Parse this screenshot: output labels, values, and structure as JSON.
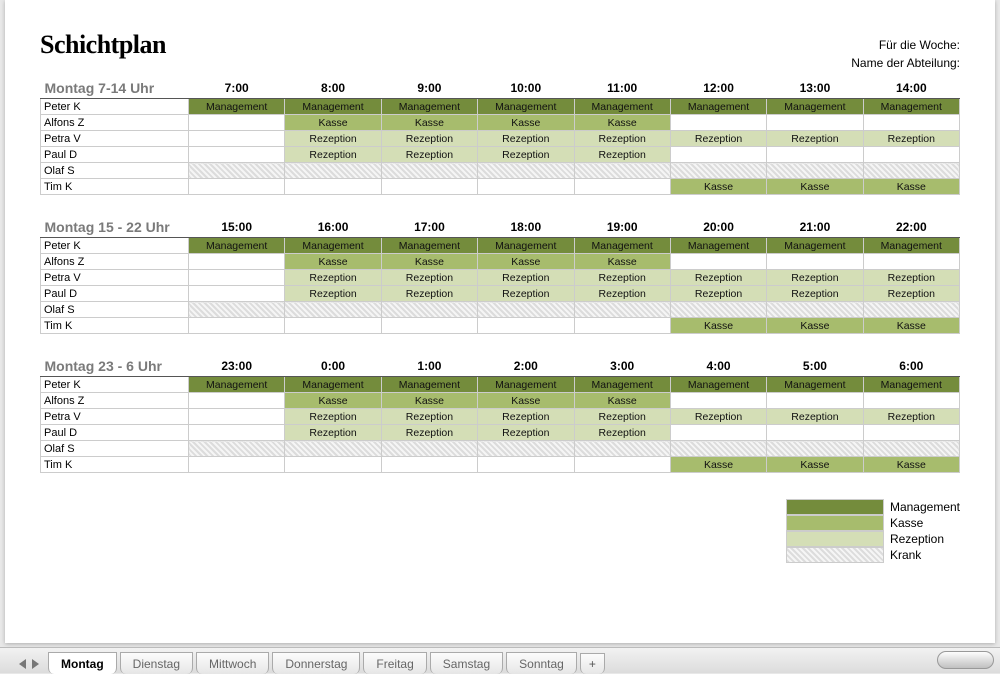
{
  "title": "Schichtplan",
  "meta": {
    "week_label": "Für die Woche:",
    "dept_label": "Name der Abteilung:"
  },
  "blocks": [
    {
      "title": "Montag 7-14 Uhr",
      "hours": [
        "7:00",
        "8:00",
        "9:00",
        "10:00",
        "11:00",
        "12:00",
        "13:00",
        "14:00"
      ],
      "rows": [
        {
          "name": "Peter K",
          "cells": [
            "Management",
            "Management",
            "Management",
            "Management",
            "Management",
            "Management",
            "Management",
            "Management"
          ]
        },
        {
          "name": "Alfons Z",
          "cells": [
            "",
            "Kasse",
            "Kasse",
            "Kasse",
            "Kasse",
            "",
            "",
            ""
          ]
        },
        {
          "name": "Petra V",
          "cells": [
            "",
            "Rezeption",
            "Rezeption",
            "Rezeption",
            "Rezeption",
            "Rezeption",
            "Rezeption",
            "Rezeption"
          ]
        },
        {
          "name": "Paul D",
          "cells": [
            "",
            "Rezeption",
            "Rezeption",
            "Rezeption",
            "Rezeption",
            "",
            "",
            ""
          ]
        },
        {
          "name": "Olaf S",
          "cells": [
            "Krank",
            "Krank",
            "Krank",
            "Krank",
            "Krank",
            "Krank",
            "Krank",
            "Krank"
          ]
        },
        {
          "name": "Tim K",
          "cells": [
            "",
            "",
            "",
            "",
            "",
            "Kasse",
            "Kasse",
            "Kasse"
          ]
        }
      ]
    },
    {
      "title": "Montag 15 - 22 Uhr",
      "hours": [
        "15:00",
        "16:00",
        "17:00",
        "18:00",
        "19:00",
        "20:00",
        "21:00",
        "22:00"
      ],
      "rows": [
        {
          "name": "Peter K",
          "cells": [
            "Management",
            "Management",
            "Management",
            "Management",
            "Management",
            "Management",
            "Management",
            "Management"
          ]
        },
        {
          "name": "Alfons Z",
          "cells": [
            "",
            "Kasse",
            "Kasse",
            "Kasse",
            "Kasse",
            "",
            "",
            ""
          ]
        },
        {
          "name": "Petra V",
          "cells": [
            "",
            "Rezeption",
            "Rezeption",
            "Rezeption",
            "Rezeption",
            "Rezeption",
            "Rezeption",
            "Rezeption"
          ]
        },
        {
          "name": "Paul D",
          "cells": [
            "",
            "Rezeption",
            "Rezeption",
            "Rezeption",
            "Rezeption",
            "Rezeption",
            "Rezeption",
            "Rezeption"
          ]
        },
        {
          "name": "Olaf S",
          "cells": [
            "Krank",
            "Krank",
            "Krank",
            "Krank",
            "Krank",
            "Krank",
            "Krank",
            "Krank"
          ]
        },
        {
          "name": "Tim K",
          "cells": [
            "",
            "",
            "",
            "",
            "",
            "Kasse",
            "Kasse",
            "Kasse"
          ]
        }
      ]
    },
    {
      "title": "Montag 23 - 6 Uhr",
      "hours": [
        "23:00",
        "0:00",
        "1:00",
        "2:00",
        "3:00",
        "4:00",
        "5:00",
        "6:00"
      ],
      "rows": [
        {
          "name": "Peter K",
          "cells": [
            "Management",
            "Management",
            "Management",
            "Management",
            "Management",
            "Management",
            "Management",
            "Management"
          ]
        },
        {
          "name": "Alfons Z",
          "cells": [
            "",
            "Kasse",
            "Kasse",
            "Kasse",
            "Kasse",
            "",
            "",
            ""
          ]
        },
        {
          "name": "Petra V",
          "cells": [
            "",
            "Rezeption",
            "Rezeption",
            "Rezeption",
            "Rezeption",
            "Rezeption",
            "Rezeption",
            "Rezeption"
          ]
        },
        {
          "name": "Paul D",
          "cells": [
            "",
            "Rezeption",
            "Rezeption",
            "Rezeption",
            "Rezeption",
            "",
            "",
            ""
          ]
        },
        {
          "name": "Olaf S",
          "cells": [
            "Krank",
            "Krank",
            "Krank",
            "Krank",
            "Krank",
            "Krank",
            "Krank",
            "Krank"
          ]
        },
        {
          "name": "Tim K",
          "cells": [
            "",
            "",
            "",
            "",
            "",
            "Kasse",
            "Kasse",
            "Kasse"
          ]
        }
      ]
    }
  ],
  "legend": [
    {
      "key": "Management",
      "label": "Management"
    },
    {
      "key": "Kasse",
      "label": "Kasse"
    },
    {
      "key": "Rezeption",
      "label": "Rezeption"
    },
    {
      "key": "Krank",
      "label": "Krank"
    }
  ],
  "tabs": {
    "items": [
      "Montag",
      "Dienstag",
      "Mittwoch",
      "Donnerstag",
      "Freitag",
      "Samstag",
      "Sonntag"
    ],
    "active": 0,
    "plus": "+"
  }
}
